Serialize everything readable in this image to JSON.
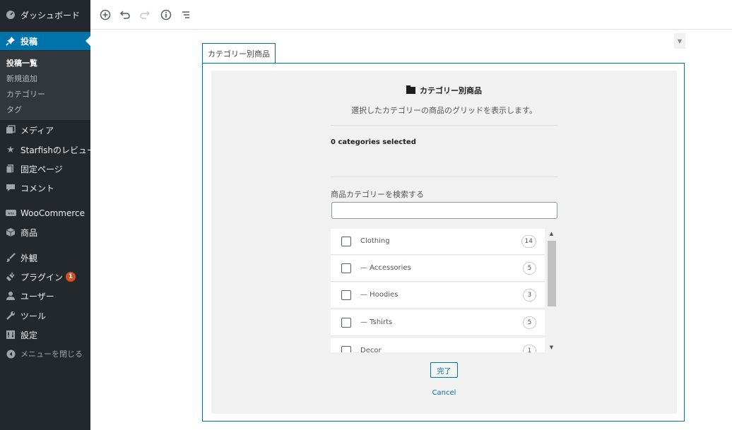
{
  "sidebar": {
    "dashboard": "ダッシュボード",
    "posts": "投稿",
    "submenu": [
      "投稿一覧",
      "新規追加",
      "カテゴリー",
      "タグ"
    ],
    "media": "メディア",
    "starfish": "Starfishのレビュー",
    "pages": "固定ページ",
    "comments": "コメント",
    "woocommerce": "WooCommerce",
    "products": "商品",
    "appearance": "外観",
    "plugins": "プラグイン",
    "plugins_badge": "1",
    "users": "ユーザー",
    "tools": "ツール",
    "settings": "設定",
    "collapse": "メニューを閉じる",
    "accent_color": "#0073aa",
    "bg_color": "#23282d"
  },
  "toolbar": {
    "icons": [
      "add-block-icon",
      "undo-icon",
      "redo-icon",
      "info-icon",
      "block-navigation-icon"
    ]
  },
  "block": {
    "tab_label": "カテゴリー別商品",
    "title": "カテゴリー別商品",
    "description": "選択したカテゴリーの商品のグリッドを表示します。",
    "selected_count": "0 categories selected",
    "search_label": "商品カテゴリーを検索する",
    "search_value": "",
    "categories": [
      {
        "label": "Clothing",
        "count": "14",
        "checked": false
      },
      {
        "label": "— Accessories",
        "count": "5",
        "checked": false
      },
      {
        "label": "— Hoodies",
        "count": "3",
        "checked": false
      },
      {
        "label": "— Tshirts",
        "count": "5",
        "checked": false
      },
      {
        "label": "Decor",
        "count": "1",
        "checked": false
      }
    ],
    "done_label": "完了",
    "cancel_label": "Cancel"
  }
}
